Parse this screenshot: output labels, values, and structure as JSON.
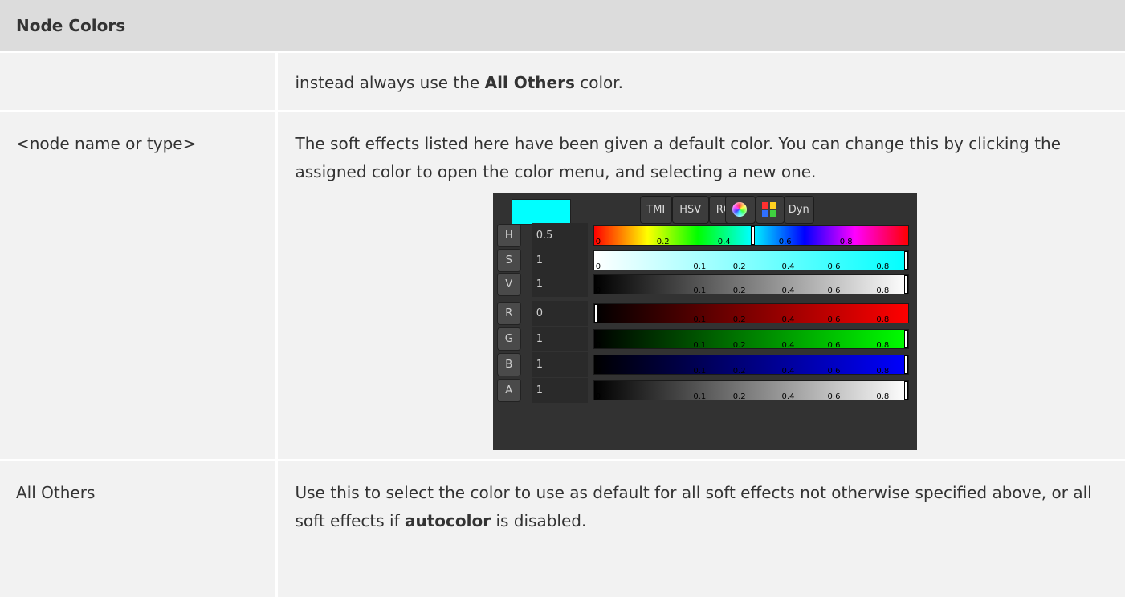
{
  "table": {
    "header": "Node Colors",
    "rows": [
      {
        "key": "",
        "value_parts": [
          "instead always use the ",
          "All Others",
          " color."
        ]
      },
      {
        "key": "<node name or type>",
        "value": "The soft effects listed here have been given a default color. You can change this by clicking the assigned color to open the color menu, and selecting a new one."
      },
      {
        "key": "All Others",
        "value_parts": [
          "Use this to select the color to use as default for all soft effects not otherwise specified above, or all soft effects if ",
          "autocolor",
          " is disabled."
        ]
      }
    ]
  },
  "picker": {
    "swatch_color": "#00ffff",
    "mode_buttons": [
      "TMI",
      "HSV",
      "RGB"
    ],
    "dyn_label": "Dyn",
    "wheel_icon": "color-wheel-icon",
    "palette_icon": "palette-grid-icon",
    "tick_labels": [
      "0",
      "0.1",
      "0.2",
      "0.4",
      "0.6",
      "0.8"
    ],
    "hue_tick_labels": [
      "0",
      "0.2",
      "0.4",
      "0.6",
      "0.8"
    ],
    "channels": [
      {
        "label": "H",
        "value": "0.5",
        "level": 0.5,
        "gradient": "hue"
      },
      {
        "label": "S",
        "value": "1",
        "level": 1,
        "gradient": "sat"
      },
      {
        "label": "V",
        "value": "1",
        "level": 1,
        "gradient": "gray"
      },
      {
        "label": "R",
        "value": "0",
        "level": 0,
        "gradient": "red"
      },
      {
        "label": "G",
        "value": "1",
        "level": 1,
        "gradient": "green"
      },
      {
        "label": "B",
        "value": "1",
        "level": 1,
        "gradient": "blue"
      },
      {
        "label": "A",
        "value": "1",
        "level": 1,
        "gradient": "gray"
      }
    ]
  }
}
